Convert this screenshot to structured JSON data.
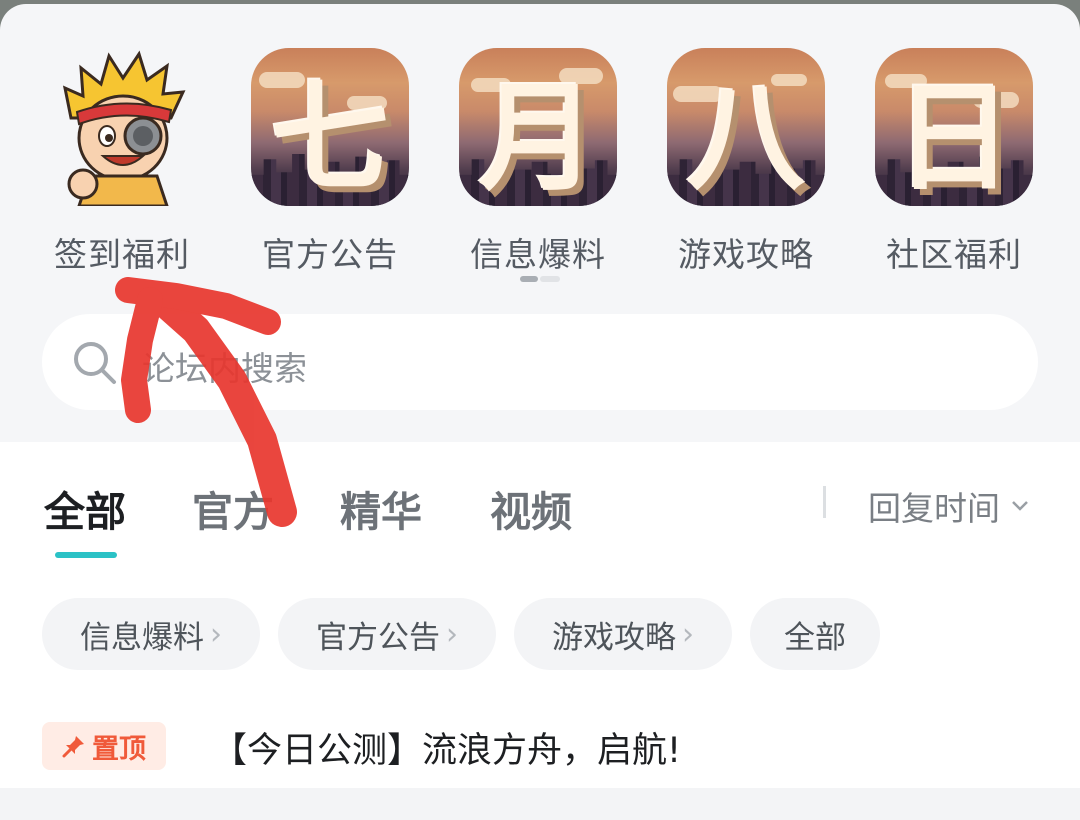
{
  "shortcuts": [
    {
      "label": "签到福利",
      "icon": "hero-avatar-icon"
    },
    {
      "label": "官方公告",
      "glyph": "七"
    },
    {
      "label": "信息爆料",
      "glyph": "月"
    },
    {
      "label": "游戏攻略",
      "glyph": "八"
    },
    {
      "label": "社区福利",
      "glyph": "日"
    }
  ],
  "search": {
    "placeholder": "论坛内搜索",
    "icon": "search-icon"
  },
  "tabs": [
    {
      "label": "全部",
      "active": true
    },
    {
      "label": "官方",
      "active": false
    },
    {
      "label": "精华",
      "active": false
    },
    {
      "label": "视频",
      "active": false
    }
  ],
  "sort": {
    "label": "回复时间",
    "icon": "chevron-down-icon"
  },
  "chips": [
    {
      "label": "信息爆料",
      "chevron": "›"
    },
    {
      "label": "官方公告",
      "chevron": "›"
    },
    {
      "label": "游戏攻略",
      "chevron": "›"
    },
    {
      "label": "全部",
      "chevron": ""
    }
  ],
  "pinned_post": {
    "badge": "置顶",
    "badge_icon": "pin-icon",
    "title": "【今日公测】流浪方舟，启航!"
  },
  "colors": {
    "accent": "#2bc2c6",
    "pin": "#f05a3a",
    "annotation": "#e8362e"
  }
}
